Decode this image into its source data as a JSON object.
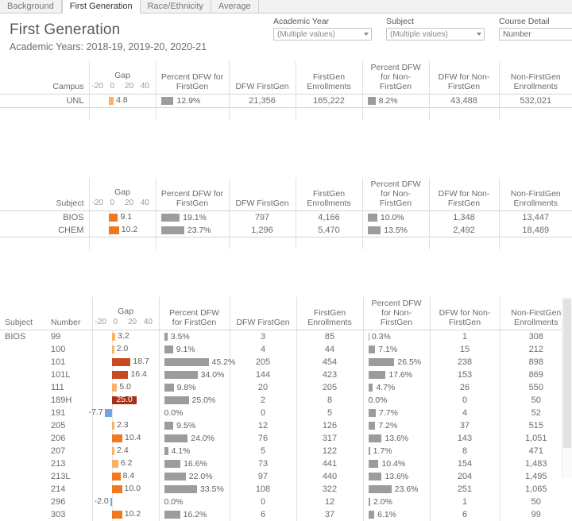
{
  "tabs": [
    {
      "label": "Background",
      "active": false
    },
    {
      "label": "First Generation",
      "active": true
    },
    {
      "label": "Race/Ethnicity",
      "active": false
    },
    {
      "label": "Average",
      "active": false
    }
  ],
  "header": {
    "title": "First Generation",
    "subtitle": "Academic Years: 2018-19, 2019-20, 2020-21"
  },
  "filters": [
    {
      "label": "Academic Year",
      "value": "(Multiple values)"
    },
    {
      "label": "Subject",
      "value": "(Multiple values)"
    },
    {
      "label": "Course Detail",
      "value": "Number"
    }
  ],
  "columns": {
    "campus": "Campus",
    "subject": "Subject",
    "number": "Number",
    "gap": "Gap",
    "pct_dfw_firstgen": "Percent DFW for FirstGen",
    "dfw_firstgen": "DFW FirstGen",
    "firstgen_enrollments": "FirstGen Enrollments",
    "pct_dfw_nonfirstgen": "Percent DFW for Non-FirstGen",
    "dfw_nonfirstgen": "DFW for Non-FirstGen",
    "nonfirstgen_enrollments": "Non-FirstGen Enrollments"
  },
  "axis": {
    "ticks": [
      "-20",
      "0",
      "20",
      "40"
    ],
    "min": -20,
    "max": 48
  },
  "colors": {
    "gap_low": "#fbb268",
    "gap_mid": "#f07820",
    "gap_high": "#c74a20",
    "gap_max": "#a8301a",
    "gap_negative": "#6fa8dc",
    "pct_bar": "#9c9c9c",
    "accent_text": "#5a5a5a"
  },
  "campus_table": {
    "rows": [
      {
        "campus": "UNL",
        "gap": 4.8,
        "gap_label": "4.8",
        "pct_dfw_firstgen": 12.9,
        "pct_dfw_firstgen_label": "12.9%",
        "dfw_firstgen": "21,356",
        "firstgen_enrollments": "165,222",
        "pct_dfw_nonfirstgen": 8.2,
        "pct_dfw_nonfirstgen_label": "8.2%",
        "dfw_nonfirstgen": "43,488",
        "nonfirstgen_enrollments": "532,021"
      }
    ]
  },
  "subject_table": {
    "rows": [
      {
        "subject": "BIOS",
        "gap": 9.1,
        "gap_label": "9.1",
        "pct_dfw_firstgen": 19.1,
        "pct_dfw_firstgen_label": "19.1%",
        "dfw_firstgen": "797",
        "firstgen_enrollments": "4,166",
        "pct_dfw_nonfirstgen": 10.0,
        "pct_dfw_nonfirstgen_label": "10.0%",
        "dfw_nonfirstgen": "1,348",
        "nonfirstgen_enrollments": "13,447"
      },
      {
        "subject": "CHEM",
        "gap": 10.2,
        "gap_label": "10.2",
        "pct_dfw_firstgen": 23.7,
        "pct_dfw_firstgen_label": "23.7%",
        "dfw_firstgen": "1,296",
        "firstgen_enrollments": "5,470",
        "pct_dfw_nonfirstgen": 13.5,
        "pct_dfw_nonfirstgen_label": "13.5%",
        "dfw_nonfirstgen": "2,492",
        "nonfirstgen_enrollments": "18,489"
      }
    ]
  },
  "detail_table": {
    "subject": "BIOS",
    "rows": [
      {
        "number": "99",
        "gap": 3.2,
        "gap_label": "3.2",
        "pct_dfw_firstgen": 3.5,
        "pct_dfw_firstgen_label": "3.5%",
        "dfw_firstgen": "3",
        "firstgen_enrollments": "85",
        "pct_dfw_nonfirstgen": 0.3,
        "pct_dfw_nonfirstgen_label": "0.3%",
        "dfw_nonfirstgen": "1",
        "nonfirstgen_enrollments": "308"
      },
      {
        "number": "100",
        "gap": 2.0,
        "gap_label": "2.0",
        "pct_dfw_firstgen": 9.1,
        "pct_dfw_firstgen_label": "9.1%",
        "dfw_firstgen": "4",
        "firstgen_enrollments": "44",
        "pct_dfw_nonfirstgen": 7.1,
        "pct_dfw_nonfirstgen_label": "7.1%",
        "dfw_nonfirstgen": "15",
        "nonfirstgen_enrollments": "212"
      },
      {
        "number": "101",
        "gap": 18.7,
        "gap_label": "18.7",
        "pct_dfw_firstgen": 45.2,
        "pct_dfw_firstgen_label": "45.2%",
        "dfw_firstgen": "205",
        "firstgen_enrollments": "454",
        "pct_dfw_nonfirstgen": 26.5,
        "pct_dfw_nonfirstgen_label": "26.5%",
        "dfw_nonfirstgen": "238",
        "nonfirstgen_enrollments": "898"
      },
      {
        "number": "101L",
        "gap": 16.4,
        "gap_label": "16.4",
        "pct_dfw_firstgen": 34.0,
        "pct_dfw_firstgen_label": "34.0%",
        "dfw_firstgen": "144",
        "firstgen_enrollments": "423",
        "pct_dfw_nonfirstgen": 17.6,
        "pct_dfw_nonfirstgen_label": "17.6%",
        "dfw_nonfirstgen": "153",
        "nonfirstgen_enrollments": "869"
      },
      {
        "number": "111",
        "gap": 5.0,
        "gap_label": "5.0",
        "pct_dfw_firstgen": 9.8,
        "pct_dfw_firstgen_label": "9.8%",
        "dfw_firstgen": "20",
        "firstgen_enrollments": "205",
        "pct_dfw_nonfirstgen": 4.7,
        "pct_dfw_nonfirstgen_label": "4.7%",
        "dfw_nonfirstgen": "26",
        "nonfirstgen_enrollments": "550"
      },
      {
        "number": "189H",
        "gap": 25.0,
        "gap_label": "25.0",
        "gap_label_inside": true,
        "pct_dfw_firstgen": 25.0,
        "pct_dfw_firstgen_label": "25.0%",
        "dfw_firstgen": "2",
        "firstgen_enrollments": "8",
        "pct_dfw_nonfirstgen": 0.0,
        "pct_dfw_nonfirstgen_label": "0.0%",
        "dfw_nonfirstgen": "0",
        "nonfirstgen_enrollments": "50"
      },
      {
        "number": "191",
        "gap": -7.7,
        "gap_label": "-7.7",
        "pct_dfw_firstgen": 0.0,
        "pct_dfw_firstgen_label": "0.0%",
        "dfw_firstgen": "0",
        "firstgen_enrollments": "5",
        "pct_dfw_nonfirstgen": 7.7,
        "pct_dfw_nonfirstgen_label": "7.7%",
        "dfw_nonfirstgen": "4",
        "nonfirstgen_enrollments": "52"
      },
      {
        "number": "205",
        "gap": 2.3,
        "gap_label": "2.3",
        "pct_dfw_firstgen": 9.5,
        "pct_dfw_firstgen_label": "9.5%",
        "dfw_firstgen": "12",
        "firstgen_enrollments": "126",
        "pct_dfw_nonfirstgen": 7.2,
        "pct_dfw_nonfirstgen_label": "7.2%",
        "dfw_nonfirstgen": "37",
        "nonfirstgen_enrollments": "515"
      },
      {
        "number": "206",
        "gap": 10.4,
        "gap_label": "10.4",
        "pct_dfw_firstgen": 24.0,
        "pct_dfw_firstgen_label": "24.0%",
        "dfw_firstgen": "76",
        "firstgen_enrollments": "317",
        "pct_dfw_nonfirstgen": 13.6,
        "pct_dfw_nonfirstgen_label": "13.6%",
        "dfw_nonfirstgen": "143",
        "nonfirstgen_enrollments": "1,051"
      },
      {
        "number": "207",
        "gap": 2.4,
        "gap_label": "2.4",
        "pct_dfw_firstgen": 4.1,
        "pct_dfw_firstgen_label": "4.1%",
        "dfw_firstgen": "5",
        "firstgen_enrollments": "122",
        "pct_dfw_nonfirstgen": 1.7,
        "pct_dfw_nonfirstgen_label": "1.7%",
        "dfw_nonfirstgen": "8",
        "nonfirstgen_enrollments": "471"
      },
      {
        "number": "213",
        "gap": 6.2,
        "gap_label": "6.2",
        "pct_dfw_firstgen": 16.6,
        "pct_dfw_firstgen_label": "16.6%",
        "dfw_firstgen": "73",
        "firstgen_enrollments": "441",
        "pct_dfw_nonfirstgen": 10.4,
        "pct_dfw_nonfirstgen_label": "10.4%",
        "dfw_nonfirstgen": "154",
        "nonfirstgen_enrollments": "1,483"
      },
      {
        "number": "213L",
        "gap": 8.4,
        "gap_label": "8.4",
        "pct_dfw_firstgen": 22.0,
        "pct_dfw_firstgen_label": "22.0%",
        "dfw_firstgen": "97",
        "firstgen_enrollments": "440",
        "pct_dfw_nonfirstgen": 13.6,
        "pct_dfw_nonfirstgen_label": "13.6%",
        "dfw_nonfirstgen": "204",
        "nonfirstgen_enrollments": "1,495"
      },
      {
        "number": "214",
        "gap": 10.0,
        "gap_label": "10.0",
        "pct_dfw_firstgen": 33.5,
        "pct_dfw_firstgen_label": "33.5%",
        "dfw_firstgen": "108",
        "firstgen_enrollments": "322",
        "pct_dfw_nonfirstgen": 23.6,
        "pct_dfw_nonfirstgen_label": "23.6%",
        "dfw_nonfirstgen": "251",
        "nonfirstgen_enrollments": "1,065"
      },
      {
        "number": "296",
        "gap": -2.0,
        "gap_label": "-2.0",
        "pct_dfw_firstgen": 0.0,
        "pct_dfw_firstgen_label": "0.0%",
        "dfw_firstgen": "0",
        "firstgen_enrollments": "12",
        "pct_dfw_nonfirstgen": 2.0,
        "pct_dfw_nonfirstgen_label": "2.0%",
        "dfw_nonfirstgen": "1",
        "nonfirstgen_enrollments": "50"
      },
      {
        "number": "303",
        "gap": 10.2,
        "gap_label": "10.2",
        "pct_dfw_firstgen": 16.2,
        "pct_dfw_firstgen_label": "16.2%",
        "dfw_firstgen": "6",
        "firstgen_enrollments": "37",
        "pct_dfw_nonfirstgen": 6.1,
        "pct_dfw_nonfirstgen_label": "6.1%",
        "dfw_nonfirstgen": "6",
        "nonfirstgen_enrollments": "99"
      }
    ]
  },
  "chart_data": {
    "type": "bar",
    "title": "First Generation",
    "subtitle": "Academic Years: 2018-19, 2019-20, 2020-21",
    "xlabel": "Gap",
    "ylabel": "",
    "xlim": [
      -20,
      48
    ],
    "grid": false,
    "legend": "none",
    "categories": [
      "99",
      "100",
      "101",
      "101L",
      "111",
      "189H",
      "191",
      "205",
      "206",
      "207",
      "213",
      "213L",
      "214",
      "296",
      "303"
    ],
    "series": [
      {
        "name": "Gap",
        "values": [
          3.2,
          2.0,
          18.7,
          16.4,
          5.0,
          25.0,
          -7.7,
          2.3,
          10.4,
          2.4,
          6.2,
          8.4,
          10.0,
          -2.0,
          10.2
        ]
      },
      {
        "name": "Percent DFW for FirstGen",
        "values": [
          3.5,
          9.1,
          45.2,
          34.0,
          9.8,
          25.0,
          0.0,
          9.5,
          24.0,
          4.1,
          16.6,
          22.0,
          33.5,
          0.0,
          16.2
        ]
      },
      {
        "name": "Percent DFW for Non-FirstGen",
        "values": [
          0.3,
          7.1,
          26.5,
          17.6,
          4.7,
          0.0,
          7.7,
          7.2,
          13.6,
          1.7,
          10.4,
          13.6,
          23.6,
          2.0,
          6.1
        ]
      },
      {
        "name": "DFW FirstGen",
        "values": [
          3,
          4,
          205,
          144,
          20,
          2,
          0,
          12,
          76,
          5,
          73,
          97,
          108,
          0,
          6
        ]
      },
      {
        "name": "FirstGen Enrollments",
        "values": [
          85,
          44,
          454,
          423,
          205,
          8,
          5,
          126,
          317,
          122,
          441,
          440,
          322,
          12,
          37
        ]
      },
      {
        "name": "DFW for Non-FirstGen",
        "values": [
          1,
          15,
          238,
          153,
          26,
          0,
          4,
          37,
          143,
          8,
          154,
          204,
          251,
          1,
          6
        ]
      },
      {
        "name": "Non-FirstGen Enrollments",
        "values": [
          308,
          212,
          898,
          869,
          550,
          50,
          52,
          515,
          1051,
          471,
          1483,
          1495,
          1065,
          50,
          99
        ]
      }
    ],
    "summary_rows": [
      {
        "level": "Campus",
        "name": "UNL",
        "gap": 4.8,
        "pct_dfw_firstgen": 12.9,
        "dfw_firstgen": 21356,
        "firstgen_enrollments": 165222,
        "pct_dfw_nonfirstgen": 8.2,
        "dfw_nonfirstgen": 43488,
        "nonfirstgen_enrollments": 532021
      },
      {
        "level": "Subject",
        "name": "BIOS",
        "gap": 9.1,
        "pct_dfw_firstgen": 19.1,
        "dfw_firstgen": 797,
        "firstgen_enrollments": 4166,
        "pct_dfw_nonfirstgen": 10.0,
        "dfw_nonfirstgen": 1348,
        "nonfirstgen_enrollments": 13447
      },
      {
        "level": "Subject",
        "name": "CHEM",
        "gap": 10.2,
        "pct_dfw_firstgen": 23.7,
        "dfw_firstgen": 1296,
        "firstgen_enrollments": 5470,
        "pct_dfw_nonfirstgen": 13.5,
        "dfw_nonfirstgen": 2492,
        "nonfirstgen_enrollments": 18489
      }
    ]
  }
}
